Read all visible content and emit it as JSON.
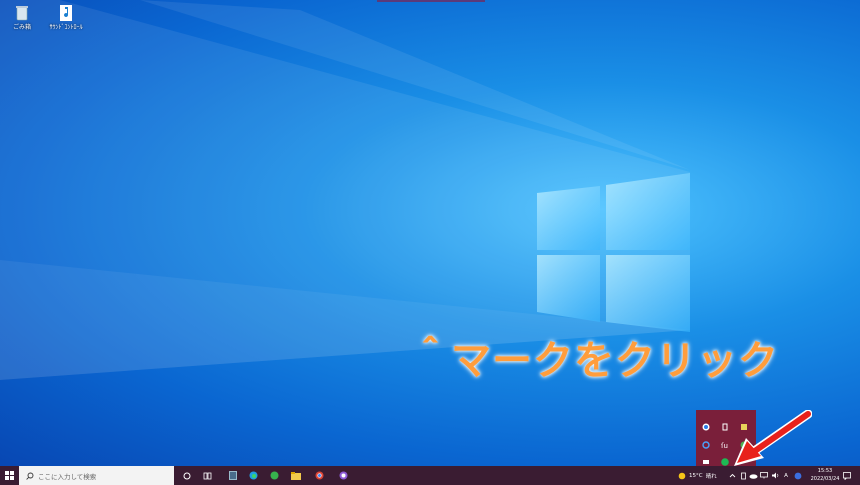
{
  "desktop": {
    "icons": [
      {
        "label": "ごみ箱",
        "icon": "recycle-bin-icon"
      },
      {
        "label": "ｻｳﾝﾄﾞｺﾝﾄﾛｰﾙ",
        "icon": "music-note-icon"
      }
    ]
  },
  "annotation": {
    "text": "＾マークをクリック"
  },
  "taskbar": {
    "search_placeholder": "ここに入力して検索",
    "weather_temp": "15°C",
    "weather_condition": "晴れ",
    "ime_mode": "A",
    "clock_time": "15:53",
    "clock_date": "2022/03/24"
  },
  "colors": {
    "accent": "#ff9d3c",
    "taskbar": "#3a1c32",
    "tray_popup": "#7a1f3a",
    "arrow": "#e8211b"
  }
}
